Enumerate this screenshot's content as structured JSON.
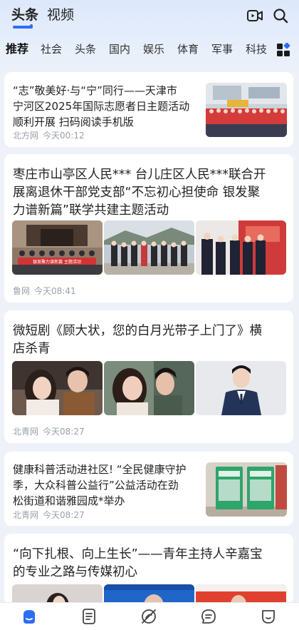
{
  "header": {
    "tabs": [
      {
        "label": "头条",
        "active": true
      },
      {
        "label": "视频",
        "active": false
      }
    ],
    "icons": [
      "video-icon",
      "search-icon"
    ]
  },
  "channels": {
    "items": [
      "推荐",
      "社会",
      "头条",
      "国内",
      "娱乐",
      "体育",
      "军事",
      "科技"
    ],
    "active": "推荐",
    "more_icon": "grid-icon"
  },
  "feed": [
    {
      "title": "“志”敬美好·与“宁”同行——天津市宁河区2025年国际志愿者日主题活动顺利开展 扫码阅读手机版",
      "title_lines": [
        "“志”敬美好·与“宁”同行——天津市",
        "宁河区2025年国际志愿者日主题活动",
        "顺利开展 扫码阅读手机版"
      ],
      "source": "北方网",
      "time": "今天00:12",
      "layout": "right-thumb"
    },
    {
      "title": "枣庄市山亭区人民*** 台儿庄区人民***联合开展离退休干部党支部“不忘初心担使命 银发聚力谱新篇”联学共建主题活动",
      "title_lines": [
        "枣庄市山亭区人民*** 台儿庄区人民***联合开",
        "展离退休干部党支部“不忘初心担使命 银发聚",
        "力谱新篇”联学共建主题活动"
      ],
      "source": "鲁网",
      "time": "今天08:41",
      "banner_text": "银发聚力谱新篇 主题活动",
      "layout": "three-thumbs"
    },
    {
      "title": "微短剧《顾大状，您的白月光带子上门了》横店杀青",
      "title_lines": [
        "微短剧《顾大状，您的白月光带子上门了》横",
        "店杀青"
      ],
      "source": "北青网",
      "time": "今天08:27",
      "layout": "three-thumbs"
    },
    {
      "title": "健康科普活动进社区! “全民健康守护季，大众科普公益行”公益活动在劲松街道和谐雅园成*举办",
      "title_lines": [
        "健康科普活动进社区! “全民健康守护",
        "季，大众科普公益行”公益活动在劲",
        "松街道和谐雅园成*举办"
      ],
      "source": "北青网",
      "time": "今天08:27",
      "layout": "right-thumb"
    },
    {
      "title": "“向下扎根、向上生长”——青年主持人辛嘉宝的专业之路与传媒初心",
      "title_lines": [
        "“向下扎根、向上生长”——青年主持人辛嘉宝",
        "的专业之路与传媒初心"
      ],
      "layout": "three-thumbs"
    }
  ],
  "bottom_nav": {
    "items": [
      "home-icon",
      "news-icon",
      "discover-icon",
      "message-icon",
      "profile-icon"
    ],
    "active": "home-icon"
  },
  "colors": {
    "accent": "#2d6df6",
    "meta_text": "#9aa0a8",
    "page_bg": "#eef2f8"
  }
}
